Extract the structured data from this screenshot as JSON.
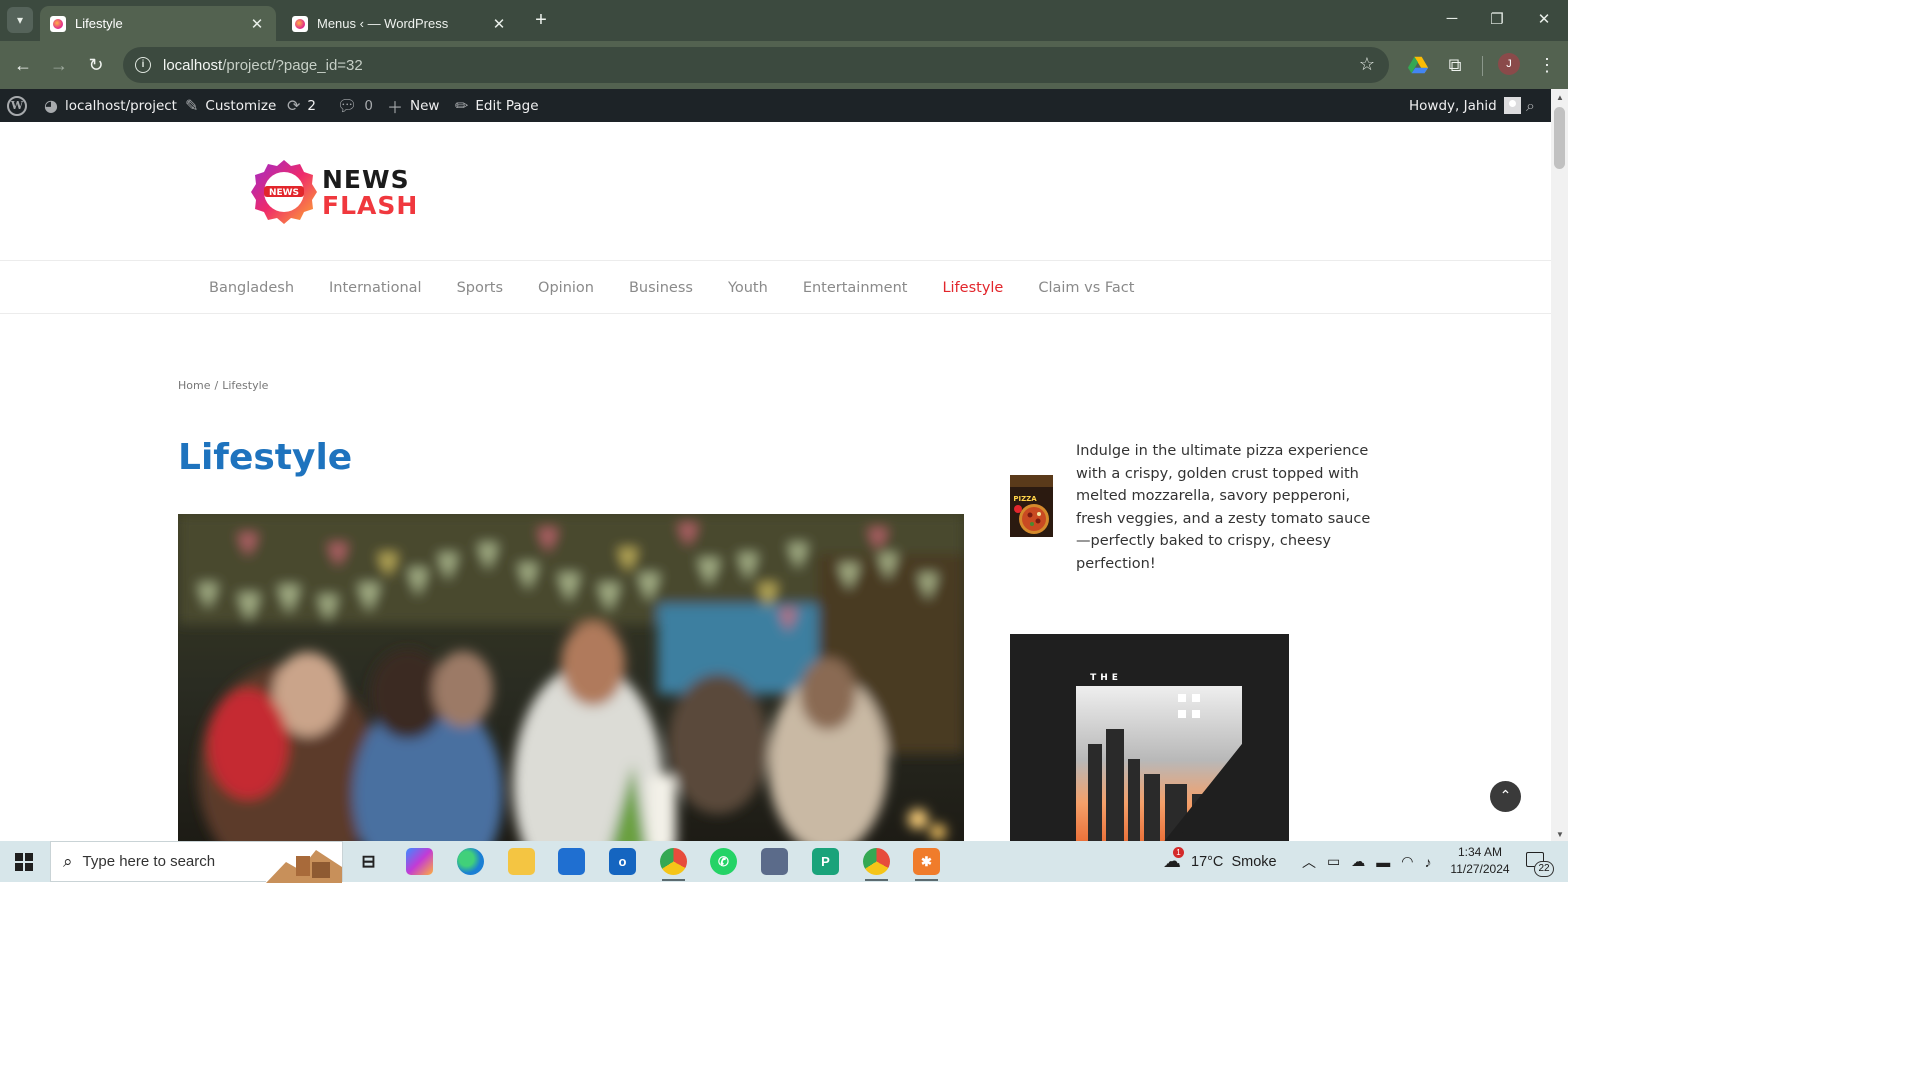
{
  "browser": {
    "tabs": [
      {
        "title": "Lifestyle",
        "active": true
      },
      {
        "title": "Menus ‹ — WordPress",
        "active": false
      }
    ],
    "url_host": "localhost",
    "url_path": "/project/?page_id=32",
    "profile_initial": "J"
  },
  "adminbar": {
    "site": "localhost/project",
    "customize": "Customize",
    "updates": "2",
    "comments": "0",
    "new": "New",
    "edit": "Edit Page",
    "howdy": "Howdy, Jahid"
  },
  "site": {
    "logo_line1": "NEWS",
    "logo_line2": "FLASH",
    "logo_badge_text": "NEWS",
    "nav": [
      {
        "label": "Bangladesh",
        "current": false
      },
      {
        "label": "International",
        "current": false
      },
      {
        "label": "Sports",
        "current": false
      },
      {
        "label": "Opinion",
        "current": false
      },
      {
        "label": "Business",
        "current": false
      },
      {
        "label": "Youth",
        "current": false
      },
      {
        "label": "Entertainment",
        "current": false
      },
      {
        "label": "Lifestyle",
        "current": true
      },
      {
        "label": "Claim vs Fact",
        "current": false
      }
    ],
    "breadcrumb": {
      "home": "Home",
      "sep": "/",
      "current": "Lifestyle"
    },
    "page_title": "Lifestyle",
    "sidebar_post_text": "Indulge in the ultimate pizza experience with a crispy, golden crust topped with melted mozzarella, savory pepperoni, fresh veggies, and a zesty tomato sauce —perfectly baked to crispy, cheesy perfection!",
    "sidebar_thumb_label": "PIZZA",
    "banner_text": "THE",
    "accent_color": "#1e73be",
    "nav_current_color": "#e2262c"
  },
  "taskbar": {
    "search_placeholder": "Type here to search",
    "weather": "17°C  Smoke",
    "weather_badge": "1",
    "time": "1:34 AM",
    "date": "11/27/2024",
    "notifications": "22"
  }
}
